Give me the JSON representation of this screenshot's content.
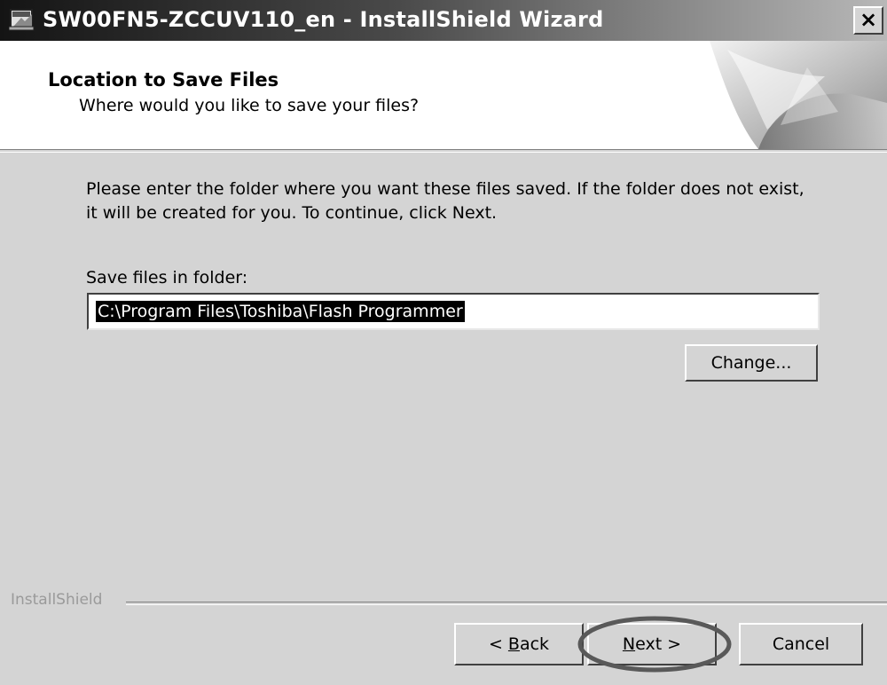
{
  "window": {
    "title": "SW00FN5-ZCCUV110_en - InstallShield Wizard",
    "close_label": "×"
  },
  "header": {
    "title": "Location to Save Files",
    "subtitle": "Where would you like to save your files?"
  },
  "body": {
    "intro": "Please enter the folder where you want these files saved.  If the folder does not exist, it will be created for you.   To continue, click Next.",
    "folder_label": "Save files in folder:",
    "folder_value": "C:\\Program Files\\Toshiba\\Flash Programmer",
    "change_label": "Change..."
  },
  "footer": {
    "brand": "InstallShield",
    "back_prefix": "< ",
    "back_mnemonic": "B",
    "back_rest": "ack",
    "next_mnemonic": "N",
    "next_rest": "ext >",
    "cancel_label": "Cancel"
  },
  "annotation": {
    "highlighted_control": "Next",
    "color": "#595959"
  },
  "icons": [
    "installer-app-icon",
    "close-icon",
    "page-curl-graphic"
  ]
}
